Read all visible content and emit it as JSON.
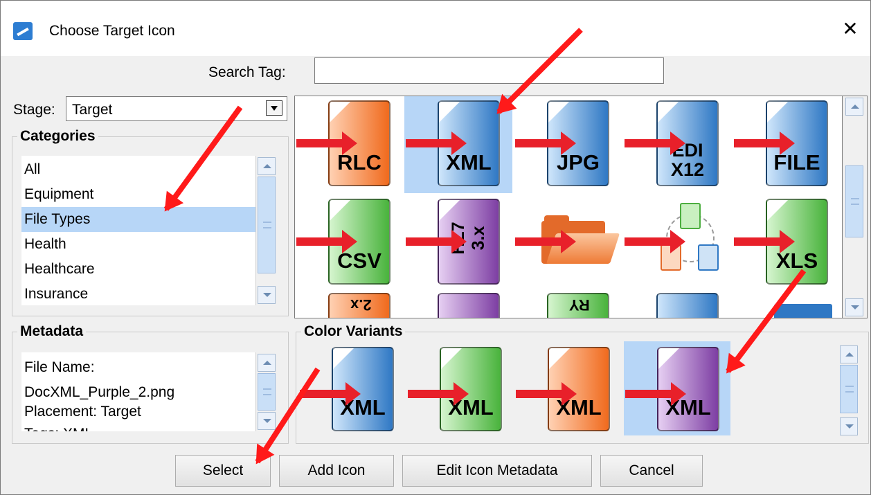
{
  "window": {
    "title": "Choose Target Icon",
    "close_label": "✕"
  },
  "search": {
    "label": "Search Tag:",
    "value": "",
    "placeholder": ""
  },
  "stage": {
    "label": "Stage:",
    "value": "Target"
  },
  "categories": {
    "title": "Categories",
    "items": [
      "All",
      "Equipment",
      "File Types",
      "Health",
      "Healthcare",
      "Insurance"
    ],
    "selected": "File Types"
  },
  "icons": {
    "row1": [
      {
        "label": "RLC",
        "color": "#f06a1d"
      },
      {
        "label": "XML",
        "color": "#2f78c4",
        "selected": true
      },
      {
        "label": "JPG",
        "color": "#2f78c4"
      },
      {
        "label_line1": "EDI",
        "label_line2": "X12",
        "color": "#2f78c4"
      },
      {
        "label": "FILE",
        "color": "#2f78c4"
      }
    ],
    "row2": [
      {
        "label": "CSV",
        "color": "#49b33c"
      },
      {
        "label": "HL7 3.x",
        "color": "#7d3ea3"
      },
      {
        "icon": "folder-icon",
        "color": "#e36a2a"
      },
      {
        "icon": "workflow-icon"
      },
      {
        "label": "XLS",
        "color": "#49b33c"
      }
    ],
    "row3_partial": [
      {
        "label": "2.x",
        "color": "#f06a1d"
      },
      {
        "label": "",
        "color": "#7d3ea3"
      },
      {
        "label": "RY",
        "color": "#49b33c"
      },
      {
        "label": "",
        "color": "#2f78c4"
      },
      {
        "icon": "window-icon",
        "color": "#2f78c4"
      }
    ]
  },
  "metadata": {
    "title": "Metadata",
    "line1": "File Name:",
    "line2": "DocXML_Purple_2.png",
    "line3": "Placement: Target",
    "line4": "Tags: XML"
  },
  "variants": {
    "title": "Color Variants",
    "items": [
      {
        "label": "XML",
        "color": "#2f78c4"
      },
      {
        "label": "XML",
        "color": "#49b33c"
      },
      {
        "label": "XML",
        "color": "#f06a1d"
      },
      {
        "label": "XML",
        "color": "#7d3ea3",
        "selected": true
      }
    ]
  },
  "buttons": {
    "select": "Select",
    "add_icon": "Add Icon",
    "edit_metadata": "Edit Icon Metadata",
    "cancel": "Cancel"
  }
}
